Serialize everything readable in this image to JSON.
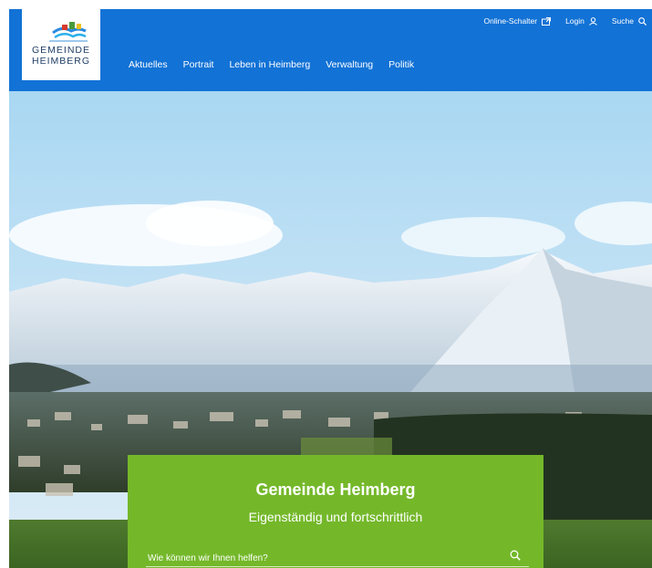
{
  "logo": {
    "line1": "GEMEINDE",
    "line2": "HEIMBERG"
  },
  "utility": [
    {
      "label": "Online-Schalter",
      "icon": "external-window-icon"
    },
    {
      "label": "Login",
      "icon": "user-icon"
    },
    {
      "label": "Suche",
      "icon": "search-icon"
    }
  ],
  "nav": [
    "Aktuelles",
    "Portrait",
    "Leben in Heimberg",
    "Verwaltung",
    "Politik"
  ],
  "hero": {
    "title": "Gemeinde Heimberg",
    "subtitle": "Eigenständig und fortschrittlich",
    "search_placeholder": "Wie können wir Ihnen helfen?"
  },
  "colors": {
    "header": "#1272d6",
    "card": "#74b82a"
  }
}
